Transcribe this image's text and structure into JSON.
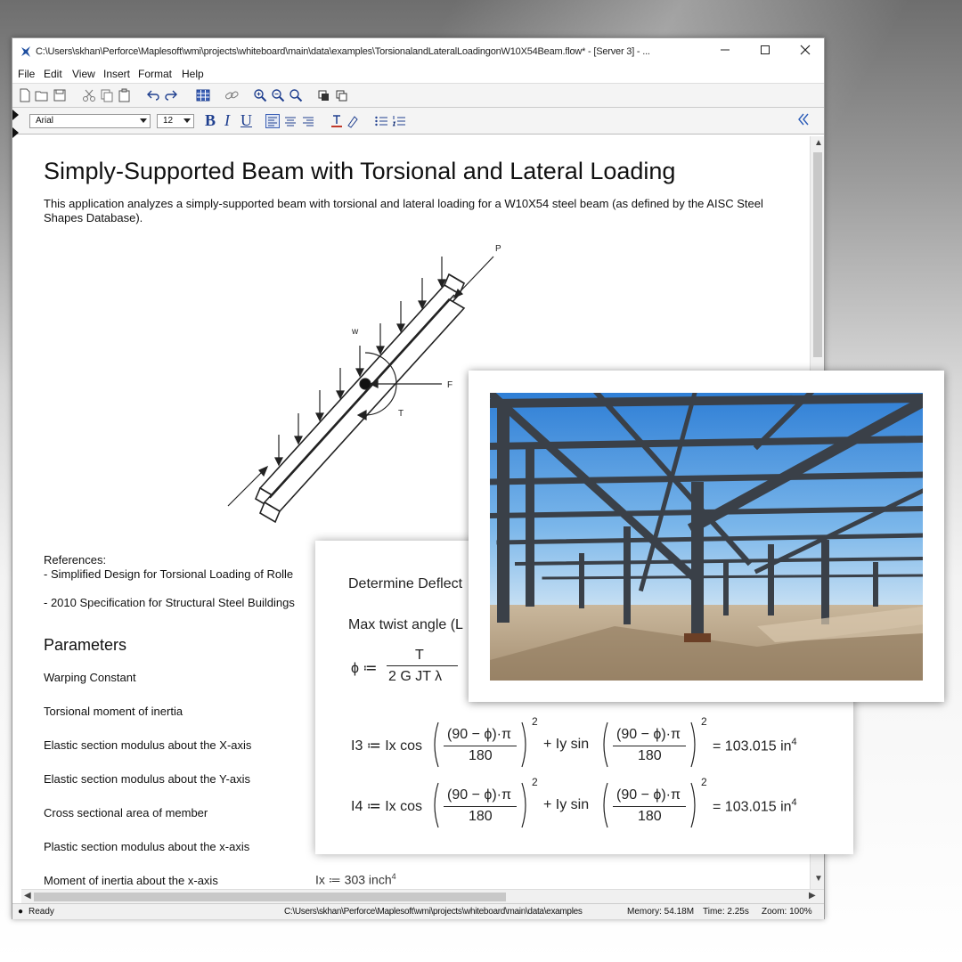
{
  "window": {
    "title": "C:\\Users\\skhan\\Perforce\\Maplesoft\\wmi\\projects\\whiteboard\\main\\data\\examples\\TorsionalandLateralLoadingonW10X54Beam.flow* - [Server 3] - ..."
  },
  "menu": {
    "file": "File",
    "edit": "Edit",
    "view": "View",
    "insert": "Insert",
    "format": "Format",
    "help": "Help"
  },
  "format_bar": {
    "font": "Arial",
    "size": "12",
    "bold": "B",
    "italic": "I",
    "underline": "U"
  },
  "document": {
    "title": "Simply-Supported Beam with Torsional and Lateral Loading",
    "intro": "This application analyzes a simply-supported beam with torsional and lateral loading for a W10X54 steel beam (as defined by the AISC Steel Shapes Database).",
    "diagram_labels": {
      "p": "P",
      "w": "w",
      "f": "F",
      "t": "T"
    },
    "references_heading": "References:",
    "references": [
      "- Simplified Design for Torsional Loading of Rolle",
      "- 2010 Specification for Structural Steel Buildings"
    ],
    "parameters_heading": "Parameters",
    "parameters": [
      "Warping Constant",
      "Torsional moment of inertia",
      "Elastic section modulus about the X-axis",
      "Elastic section modulus about the Y-axis",
      "Cross sectional area of member",
      "Plastic section modulus about the x-axis",
      "Moment of inertia about the x-axis"
    ],
    "ix_formula": {
      "lhs": "Ix ≔ 303 inch",
      "exp": "4"
    }
  },
  "overlay": {
    "heading": "Determine Deflect",
    "twist_label": "Max twist angle (L",
    "phi_lhs": "ϕ ≔",
    "phi_numerator": "T",
    "phi_denominator": "2 G JT λ",
    "i3": {
      "lhs": "I3 ≔ Ix cos",
      "num": "(90 − ϕ)·π",
      "den": "180",
      "mid": "+ Iy sin",
      "exp": "2",
      "result": "= 103.015 in",
      "result_exp": "4"
    },
    "i4": {
      "lhs": "I4 ≔ Ix cos",
      "num": "(90 − ϕ)·π",
      "den": "180",
      "mid": "+ Iy sin",
      "exp": "2",
      "result": "= 103.015 in",
      "result_exp": "4"
    }
  },
  "status": {
    "state": "Ready",
    "path": "C:\\Users\\skhan\\Perforce\\Maplesoft\\wmi\\projects\\whiteboard\\main\\data\\examples",
    "memory": "Memory: 54.18M",
    "time": "Time: 2.25s",
    "zoom": "Zoom: 100%"
  }
}
